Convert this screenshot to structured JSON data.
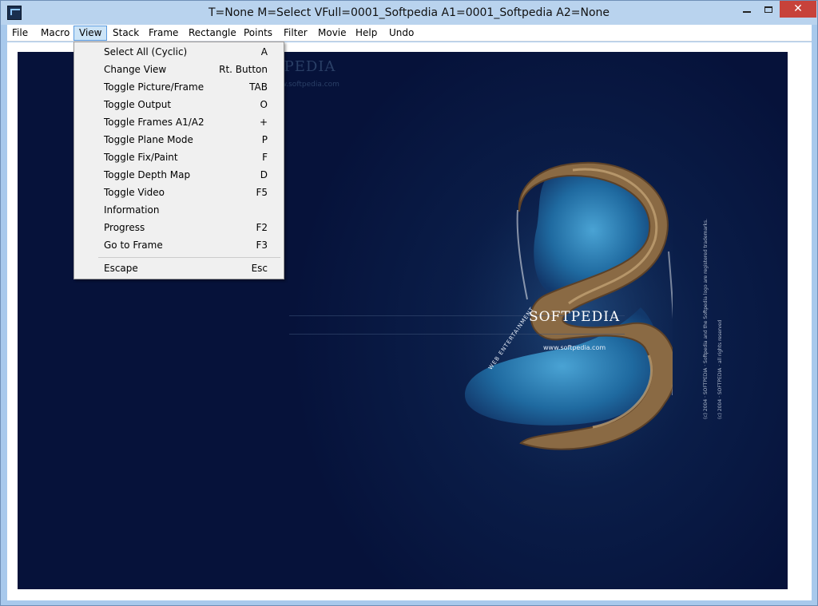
{
  "window": {
    "title": "T=None M=Select VFull=0001_Softpedia  A1=0001_Softpedia  A2=None",
    "close_glyph": "✕"
  },
  "menubar": {
    "items": [
      "File",
      "Macro",
      "View",
      "Stack",
      "Frame",
      "Rectangle",
      "Points",
      "Filter",
      "Movie",
      "Help",
      "Undo"
    ],
    "active": "View"
  },
  "view_menu": {
    "items": [
      {
        "label": "Select All (Cyclic)",
        "key": "A"
      },
      {
        "label": "Change View",
        "key": "Rt. Button"
      },
      {
        "label": "Toggle Picture/Frame",
        "key": "TAB"
      },
      {
        "label": "Toggle Output",
        "key": "O"
      },
      {
        "label": "Toggle Frames A1/A2",
        "key": "+"
      },
      {
        "label": "Toggle Plane Mode",
        "key": "P"
      },
      {
        "label": "Toggle Fix/Paint",
        "key": "F"
      },
      {
        "label": "Toggle Depth Map",
        "key": "D"
      },
      {
        "label": "Toggle Video",
        "key": "F5"
      },
      {
        "label": "Information",
        "key": ""
      },
      {
        "label": "Progress",
        "key": "F2"
      },
      {
        "label": "Go to Frame",
        "key": "F3"
      },
      {
        "label": "Escape",
        "key": "Esc"
      }
    ]
  },
  "image": {
    "brand": "SOFTPEDIA",
    "brand_url": "www.softpedia.com",
    "tagline": "WEB ENTERTAINMENT",
    "watermark": "SOFTPEDIA",
    "watermark_url": "www.softpedia.com",
    "note_1": "(c) 2004 · SOFTPEDIA · Softpedia and the Softpedia logo are registered trademarks.",
    "note_2": "(c) 2004 · SOFTPEDIA · all rights reserved"
  },
  "colors": {
    "title_bar": "#b9d3ee",
    "close_button": "#c7423a",
    "canvas_bg": "#06123a",
    "menu_highlight": "#cce4f7"
  }
}
